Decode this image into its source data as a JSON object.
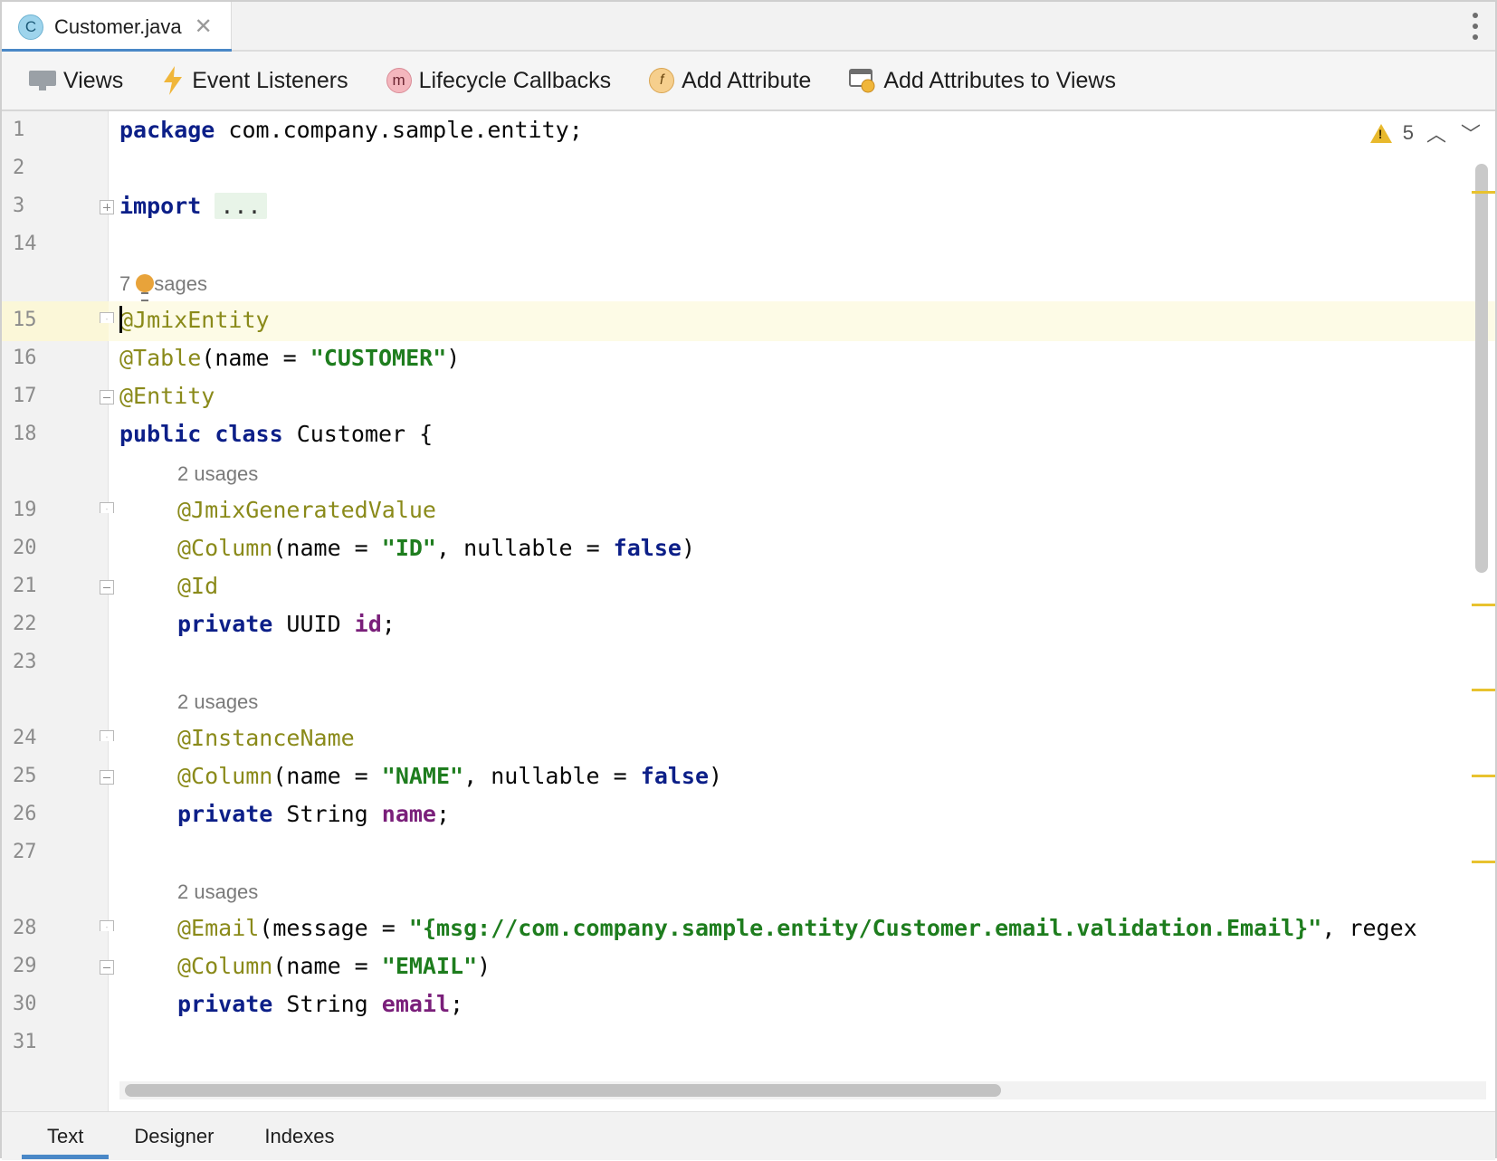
{
  "file_tab": {
    "icon_letter": "C",
    "name": "Customer.java"
  },
  "toolbar": {
    "views": "Views",
    "event_listeners": "Event Listeners",
    "lifecycle_callbacks": "Lifecycle Callbacks",
    "lifecycle_icon_letter": "m",
    "add_attribute": "Add Attribute",
    "add_attribute_icon_letter": "f",
    "add_attributes_to_views": "Add Attributes to Views"
  },
  "inspection": {
    "warning_count": "5"
  },
  "code": {
    "l1": {
      "ln": "1",
      "kw": "package",
      "rest": " com.company.sample.entity;"
    },
    "l2": {
      "ln": "2"
    },
    "l3": {
      "ln": "3",
      "kw": "import",
      "folded": "..."
    },
    "l14": {
      "ln": "14"
    },
    "hint_7": {
      "count": "7",
      "text": "sages"
    },
    "l15": {
      "ln": "15",
      "an": "@JmixEntity"
    },
    "l16": {
      "ln": "16",
      "an": "@Table",
      "p1": "(name = ",
      "st": "\"CUSTOMER\"",
      "p2": ")"
    },
    "l17": {
      "ln": "17",
      "an": "@Entity"
    },
    "l18": {
      "ln": "18",
      "kw1": "public",
      "kw2": "class",
      "rest": " Customer {"
    },
    "hint_a": "2 usages",
    "l19": {
      "ln": "19",
      "an": "@JmixGeneratedValue"
    },
    "l20": {
      "ln": "20",
      "an": "@Column",
      "p1": "(name = ",
      "st": "\"ID\"",
      "p2": ", nullable = ",
      "kw": "false",
      "p3": ")"
    },
    "l21": {
      "ln": "21",
      "an": "@Id"
    },
    "l22": {
      "ln": "22",
      "kw": "private",
      "type": " UUID ",
      "fd": "id",
      "end": ";"
    },
    "l23": {
      "ln": "23"
    },
    "hint_b": "2 usages",
    "l24": {
      "ln": "24",
      "an": "@InstanceName"
    },
    "l25": {
      "ln": "25",
      "an": "@Column",
      "p1": "(name = ",
      "st": "\"NAME\"",
      "p2": ", nullable = ",
      "kw": "false",
      "p3": ")"
    },
    "l26": {
      "ln": "26",
      "kw": "private",
      "type": " String ",
      "fd": "name",
      "end": ";"
    },
    "l27": {
      "ln": "27"
    },
    "hint_c": "2 usages",
    "l28": {
      "ln": "28",
      "an": "@Email",
      "p1": "(message = ",
      "st": "\"{msg://com.company.sample.entity/Customer.email.validation.Email}\"",
      "p2": ", regex"
    },
    "l29": {
      "ln": "29",
      "an": "@Column",
      "p1": "(name = ",
      "st": "\"EMAIL\"",
      "p2": ")"
    },
    "l30": {
      "ln": "30",
      "kw": "private",
      "type": " String ",
      "fd": "email",
      "end": ";"
    },
    "l31": {
      "ln": "31"
    }
  },
  "bottom_tabs": {
    "text": "Text",
    "designer": "Designer",
    "indexes": "Indexes"
  },
  "colors": {
    "accent": "#4a88c7",
    "keyword": "#0c1f88",
    "annotation": "#8a8a1a",
    "string": "#1e7d1e",
    "field": "#7a1f7a",
    "warning": "#e8c22e"
  }
}
